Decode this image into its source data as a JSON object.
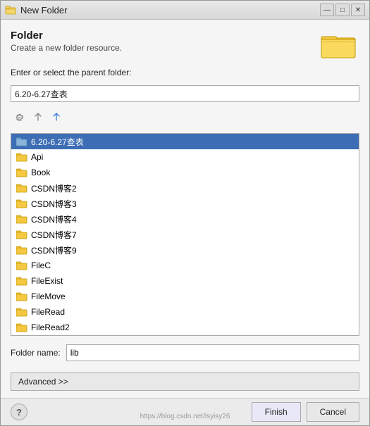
{
  "window": {
    "title": "New Folder",
    "controls": {
      "minimize": "—",
      "maximize": "□",
      "close": "✕"
    }
  },
  "header": {
    "title": "Folder",
    "subtitle": "Create a new folder resource."
  },
  "parent_folder_label": "Enter or select the parent folder:",
  "parent_folder_value": "6.20-6.27查表",
  "toolbar": {
    "back_title": "back",
    "forward_title": "forward",
    "up_title": "up"
  },
  "tree_items": [
    {
      "label": "6.20-6.27查表",
      "selected": true
    },
    {
      "label": "Api",
      "selected": false
    },
    {
      "label": "Book",
      "selected": false
    },
    {
      "label": "CSDN博客2",
      "selected": false
    },
    {
      "label": "CSDN博客3",
      "selected": false
    },
    {
      "label": "CSDN博客4",
      "selected": false
    },
    {
      "label": "CSDN博客7",
      "selected": false
    },
    {
      "label": "CSDN博客9",
      "selected": false
    },
    {
      "label": "FileC",
      "selected": false
    },
    {
      "label": "FileExist",
      "selected": false
    },
    {
      "label": "FileMove",
      "selected": false
    },
    {
      "label": "FileRead",
      "selected": false
    },
    {
      "label": "FileRead2",
      "selected": false
    }
  ],
  "folder_name_label": "Folder name:",
  "folder_name_value": "lib",
  "advanced_btn_label": "Advanced >>",
  "footer": {
    "help_label": "?",
    "finish_label": "Finish",
    "cancel_label": "Cancel"
  },
  "watermark": "https://blog.csdn.net/lsyisy26"
}
